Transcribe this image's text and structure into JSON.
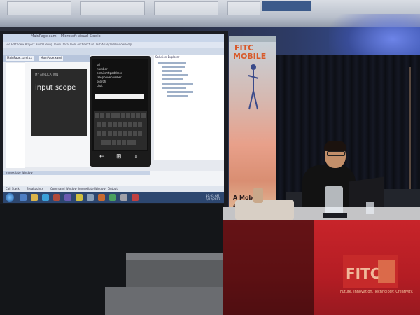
{
  "screen": {
    "ide_title": "MainPage.xaml - Microsoft Visual Studio",
    "ide_menu": "File  Edit  View  Project  Build  Debug  Team  Data  Tools  Architecture  Test  Analyze  Window  Help",
    "tabs": [
      "MainPage.xaml.cs",
      "MainPage.xaml"
    ],
    "phone_app_name": "MY APPLICATION",
    "phone_page_title": "input scope",
    "solution_explorer_title": "Solution Explorer",
    "bottom_panel_title": "Immediate Window",
    "status_items": [
      "Call Stack",
      "Breakpoints",
      "Command Window",
      "Immediate Window",
      "Output"
    ],
    "clock": [
      "10:03 AM",
      "6/22/2012"
    ]
  },
  "emulator": {
    "items": [
      "url",
      "number",
      "emailsmtpaddress",
      "telephonenumber",
      "search",
      "chat"
    ]
  },
  "banner": {
    "line1": "FITC",
    "line2": "MOBILE",
    "slogan_1": "A Mob",
    "slogan_2": "evolu"
  },
  "table": {
    "logo_text": "FITC",
    "footer_text": "Future. Innovation. Technology. Creativity."
  },
  "colors": {
    "tablecloth": "#b41d24",
    "banner_accent": "#d85a2a",
    "taskbar": "#2d4770"
  }
}
